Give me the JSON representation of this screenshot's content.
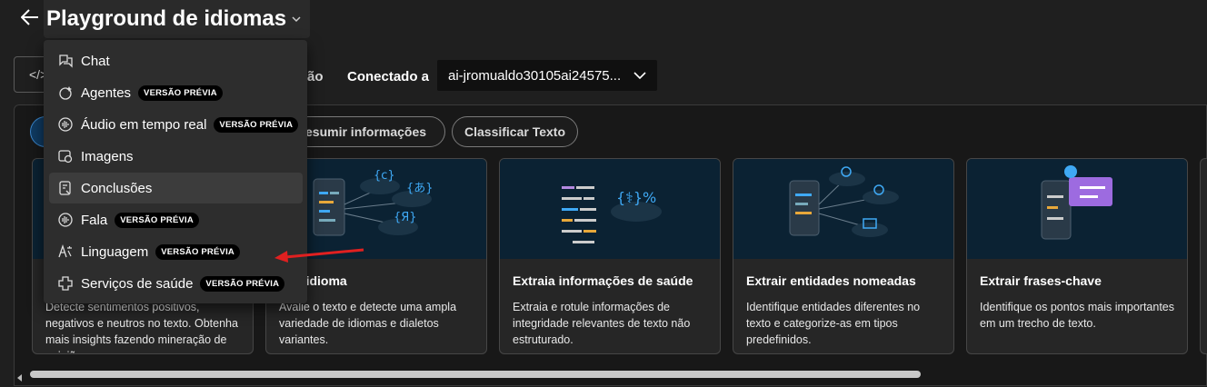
{
  "header": {
    "title": "Playground de idiomas"
  },
  "toolbar": {
    "view_code_label": "</>",
    "partial_label": "ão",
    "connected_label": "Conectado a",
    "resource_value": "ai-jromualdo30105ai24575..."
  },
  "filters": [
    {
      "label": "esumir informações"
    },
    {
      "label": "Classificar Texto"
    }
  ],
  "cards": [
    {
      "title": "",
      "desc": "Detecte sentimentos positivos, negativos e neutros no texto. Obtenha mais insights fazendo mineração de opiniões."
    },
    {
      "title": "ctar idioma",
      "desc": "Avalie o texto e detecte uma ampla variedade de idiomas e dialetos variantes."
    },
    {
      "title": "Extraia informações de saúde",
      "desc": "Extraia e rotule informações de integridade relevantes de texto não estruturado."
    },
    {
      "title": "Extrair entidades nomeadas",
      "desc": "Identifique entidades diferentes no texto e categorize-as em tipos predefinidos."
    },
    {
      "title": "Extrair frases-chave",
      "desc": "Identifique os pontos mais importantes em um trecho de texto."
    }
  ],
  "menu": {
    "items": [
      {
        "label": "Chat",
        "badge": "",
        "icon": "chat-icon"
      },
      {
        "label": "Agentes",
        "badge": "VERSÃO PRÉVIA",
        "icon": "agents-icon"
      },
      {
        "label": "Áudio em tempo real",
        "badge": "VERSÃO PRÉVIA",
        "icon": "audio-icon"
      },
      {
        "label": "Imagens",
        "badge": "",
        "icon": "images-icon"
      },
      {
        "label": "Conclusões",
        "badge": "",
        "icon": "completions-icon"
      },
      {
        "label": "Fala",
        "badge": "VERSÃO PRÉVIA",
        "icon": "speech-icon"
      },
      {
        "label": "Linguagem",
        "badge": "VERSÃO PRÉVIA",
        "icon": "language-icon"
      },
      {
        "label": "Serviços de saúde",
        "badge": "VERSÃO PRÉVIA",
        "icon": "health-icon"
      }
    ],
    "active_index": 4
  },
  "colors": {
    "accent": "#3a84c8",
    "arrow": "#e02020",
    "card_image_bg": "#0b2233"
  }
}
